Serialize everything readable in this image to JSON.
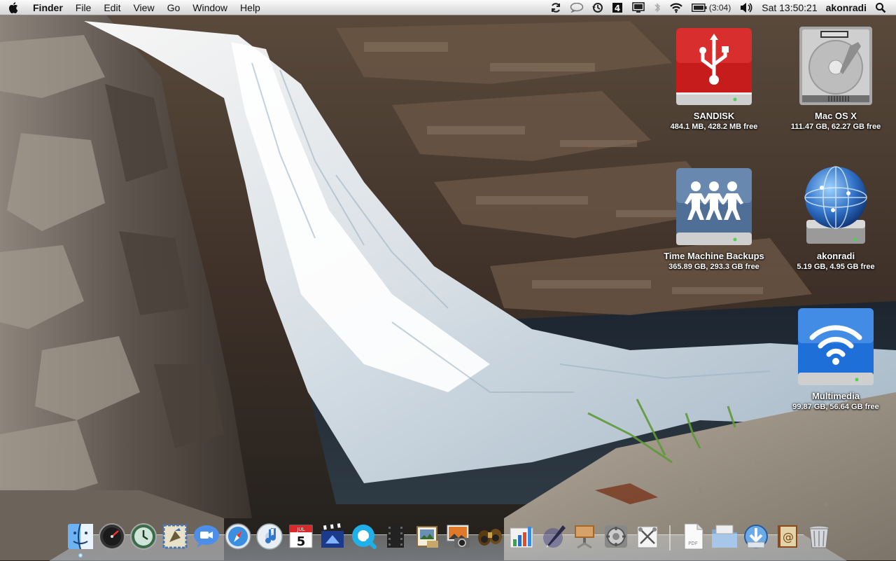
{
  "menubar": {
    "apple_icon": "apple-logo-icon",
    "app_name": "Finder",
    "menus": [
      "File",
      "Edit",
      "View",
      "Go",
      "Window",
      "Help"
    ],
    "status_icons": [
      "sync-icon",
      "speech-bubble-icon",
      "time-machine-icon",
      "spaces-icon",
      "display-icon",
      "bluetooth-icon",
      "wifi-icon",
      "battery-icon",
      "volume-icon"
    ],
    "battery_time": "(3:04)",
    "clock": "Sat 13:50:21",
    "user": "akonradi",
    "spotlight_icon": "spotlight-icon"
  },
  "desktop_icons": [
    {
      "name": "SANDISK",
      "info": "484.1 MB, 428.2 MB free",
      "icon": "usb-drive-icon"
    },
    {
      "name": "Mac OS X",
      "info": "111.47 GB, 62.27 GB free",
      "icon": "hard-disk-icon"
    },
    {
      "name": "Time Machine Backups",
      "info": "365.89 GB, 293.3 GB free",
      "icon": "shared-drive-icon"
    },
    {
      "name": "akonradi",
      "info": "5.19 GB, 4.95 GB free",
      "icon": "network-drive-icon"
    },
    {
      "name": "Multimedia",
      "info": "99.87 GB, 56.64 GB free",
      "icon": "wifi-drive-icon"
    }
  ],
  "dock": {
    "apps": [
      "finder-icon",
      "dashboard-icon",
      "time-machine-icon",
      "mail-icon",
      "ichat-icon",
      "safari-icon",
      "itunes-icon",
      "ical-icon",
      "imovie-icon",
      "quicktime-icon",
      "film-strip-icon",
      "preview-icon",
      "iphoto-icon",
      "binoculars-icon",
      "numbers-icon",
      "pen-icon",
      "keynote-icon",
      "system-preferences-icon",
      "script-editor-icon"
    ],
    "ical_date": "5",
    "ical_month": "JUL",
    "stacks": [
      "pdf-document-icon",
      "applications-folder-icon",
      "downloads-icon",
      "address-book-icon",
      "trash-icon"
    ]
  },
  "colors": {
    "menubar": "#e6e6e6",
    "usb_red": "#d21f1f",
    "network_blue": "#2f6fc4"
  }
}
